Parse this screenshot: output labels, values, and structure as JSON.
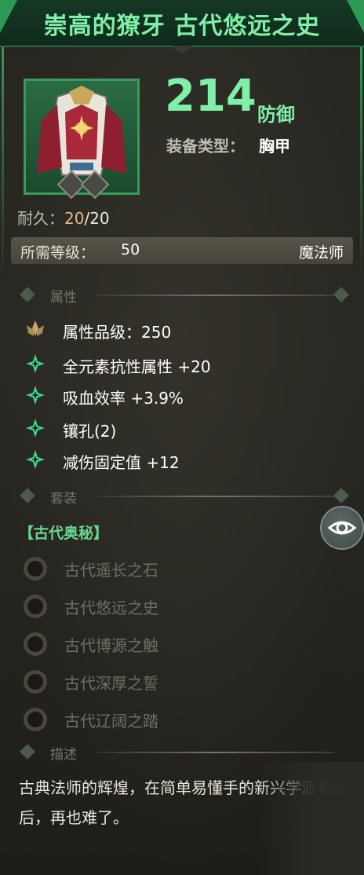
{
  "header": {
    "title": "崇高的獠牙 古代悠远之史"
  },
  "item": {
    "defense_value": "214",
    "defense_label": "防御",
    "type_label": "装备类型：",
    "type_value": "胸甲",
    "durability_label": "耐久：",
    "durability_current": "20",
    "durability_max": "/20",
    "requirement_label": "所需等级：",
    "requirement_level": "50",
    "requirement_class": "魔法师"
  },
  "sections": {
    "attributes": "属性",
    "set": "套装",
    "description": "描述"
  },
  "attributes": [
    {
      "text": "属性品级：250",
      "icon": "lotus-icon"
    },
    {
      "text": "全元素抗性属性 +20",
      "icon": "sparkle-icon"
    },
    {
      "text": "吸血效率 +3.9%",
      "icon": "sparkle-icon"
    },
    {
      "text": "镶孔(2)",
      "icon": "sparkle-icon"
    },
    {
      "text": "减伤固定值 +12",
      "icon": "sparkle-icon"
    }
  ],
  "set": {
    "name": "【古代奥秘】",
    "items": [
      "古代遥长之石",
      "古代悠远之史",
      "古代博源之触",
      "古代深厚之誓",
      "古代辽阔之踏"
    ]
  },
  "description": "古典法师的辉煌，在简单易懂手的新兴学派崛起后，再也难了。",
  "colors": {
    "accent_green": "#7ff0a8",
    "set_name_green": "#69d88e",
    "durability_current": "#e9b48a"
  }
}
